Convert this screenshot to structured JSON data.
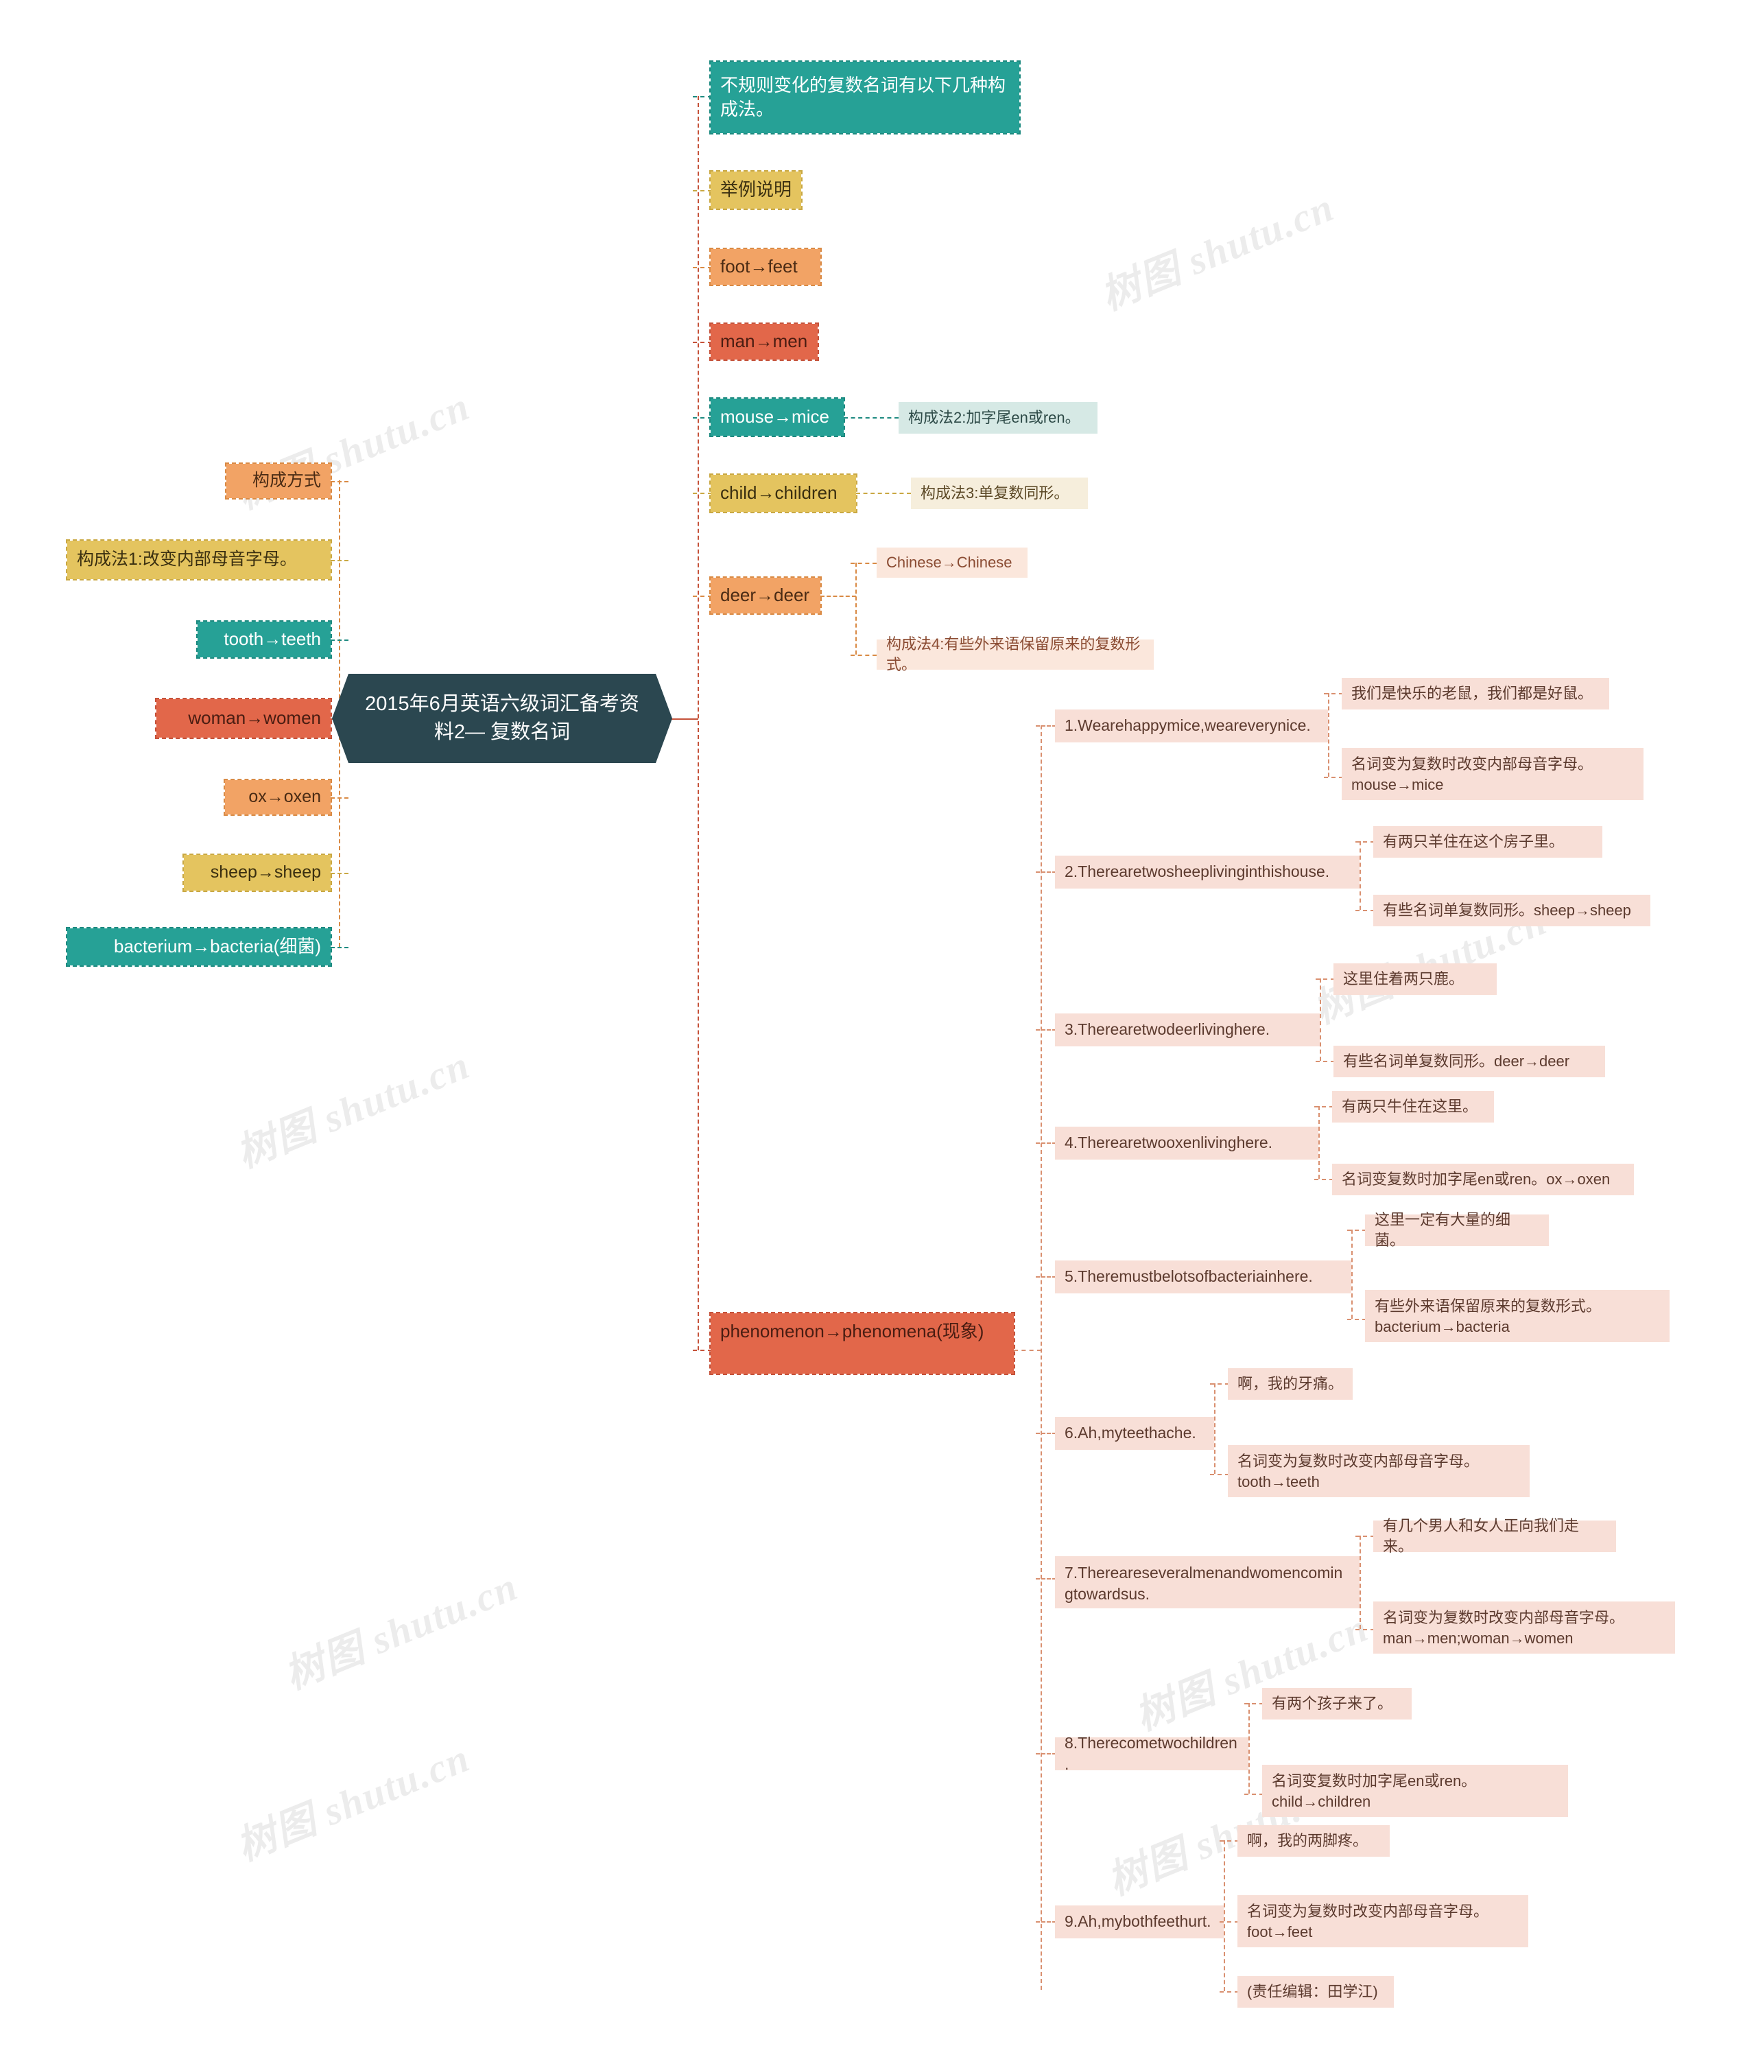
{
  "title": "2015年6月英语六级词汇备考资料2— 复数名词",
  "colors": {
    "teal": "#26A196",
    "gold": "#E4C45F",
    "orange": "#F2A365",
    "red": "#E2674A",
    "slate": "#2B4750",
    "mint": "#D6E9E5",
    "cream": "#F6EEDC",
    "peach": "#FBE7DC",
    "pink": "#F8DFD7"
  },
  "left_branch": {
    "nodes": [
      {
        "label": "构成方式",
        "color": "orange"
      },
      {
        "label": "构成法1:改变内部母音字母。",
        "color": "gold"
      },
      {
        "label": "tooth→teeth",
        "color": "teal"
      },
      {
        "label": "woman→women",
        "color": "red"
      },
      {
        "label": "ox→oxen",
        "color": "orange"
      },
      {
        "label": "sheep→sheep",
        "color": "gold"
      },
      {
        "label": "bacterium→bacteria(细菌)",
        "color": "teal"
      }
    ]
  },
  "right_branch": {
    "nodes": [
      {
        "label": "不规则变化的复数名词有以下几种构成法。",
        "color": "teal"
      },
      {
        "label": "举例说明",
        "color": "gold"
      },
      {
        "label": "foot→feet",
        "color": "orange"
      },
      {
        "label": "man→men",
        "color": "red"
      },
      {
        "label": "mouse→mice",
        "color": "teal"
      },
      {
        "label": "child→children",
        "color": "gold"
      },
      {
        "label": "deer→deer",
        "color": "orange"
      },
      {
        "label": "phenomenon→phenomena(现象)",
        "color": "red"
      }
    ],
    "annotations": {
      "mouse_note": "构成法2:加字尾en或ren。",
      "child_note": "构成法3:单复数同形。",
      "deer_child_1": "Chinese→Chinese",
      "deer_child_2": "构成法4:有些外来语保留原来的复数形式。"
    }
  },
  "examples": [
    {
      "sentence": "1.Wearehappymice,weareverynice.",
      "translation": "我们是快乐的老鼠，我们都是好鼠。",
      "rule": "名词变为复数时改变内部母音字母。mouse→mice"
    },
    {
      "sentence": "2.Therearetwosheeplivinginthishouse.",
      "translation": "有两只羊住在这个房子里。",
      "rule": "有些名词单复数同形。sheep→sheep"
    },
    {
      "sentence": "3.Therearetwodeerlivinghere.",
      "translation": "这里住着两只鹿。",
      "rule": "有些名词单复数同形。deer→deer"
    },
    {
      "sentence": "4.Therearetwooxenlivinghere.",
      "translation": "有两只牛住在这里。",
      "rule": "名词变复数时加字尾en或ren。ox→oxen"
    },
    {
      "sentence": "5.Theremustbelotsofbacteriainhere.",
      "translation": "这里一定有大量的细菌。",
      "rule": "有些外来语保留原来的复数形式。bacterium→bacteria"
    },
    {
      "sentence": "6.Ah,myteethache.",
      "translation": "啊，我的牙痛。",
      "rule": "名词变为复数时改变内部母音字母。tooth→teeth"
    },
    {
      "sentence": "7.Thereareseveralmenandwomencomingtowardsus.",
      "translation": "有几个男人和女人正向我们走来。",
      "rule": "名词变为复数时改变内部母音字母。man→men;woman→women"
    },
    {
      "sentence": "8.Therecometwochildren.",
      "translation": "有两个孩子来了。",
      "rule": "名词变复数时加字尾en或ren。child→children"
    },
    {
      "sentence": "9.Ah,mybothfeethurt.",
      "translation": "啊，我的两脚疼。",
      "rule": "名词变为复数时改变内部母音字母。foot→feet"
    }
  ],
  "editor_note": "(责任编辑：田学江)",
  "watermarks": [
    "树图 shutu.cn",
    "树图 shutu.cn",
    "树图 shutu.cn",
    "树图 shutu.cn",
    "树图 shutu.cn",
    "树图 shutu.cn",
    "树图 shutu.cn",
    "树图 shutu.cn"
  ]
}
